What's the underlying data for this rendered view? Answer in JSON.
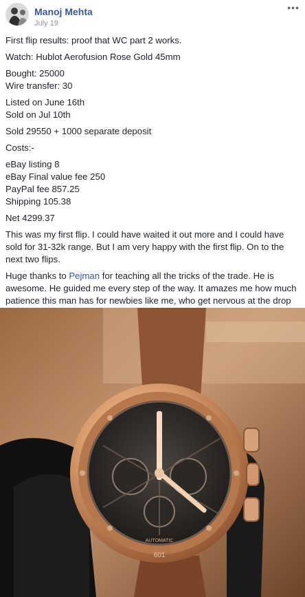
{
  "post": {
    "author": "Manoj Mehta",
    "date": "July 19",
    "more_label": "•••",
    "paragraphs": {
      "p1": "First flip results: proof that WC part 2 works.",
      "p2": "Watch: Hublot Aerofusion Rose Gold 45mm",
      "p3a": "Bought: 25000",
      "p3b": "Wire transfer: 30",
      "p4a": "Listed on June 16th",
      "p4b": "Sold on Jul 10th",
      "p5": "Sold 29550 + 1000 separate deposit",
      "p6": "Costs:-",
      "p7a": "eBay listing 8",
      "p7b": "eBay Final value fee 250",
      "p7c": "PayPal fee 857.25",
      "p7d": "Shipping 105.38",
      "p8": "Net 4299.37",
      "p9": "This was my first flip. I could have waited it out more and I could have sold for 31-32k range. But I am very happy with the first flip. On to the next two flips.",
      "p10_before": "Huge thanks to ",
      "p10_link": "Pejman",
      "p10_after": " for teaching all the tricks of the trade. He is awesome. He guided me every step of the way. It amazes me how much patience this man has for newbies like me, who get nervous at the drop of the hat. Thanks again PJ."
    },
    "photo": {
      "dial_text": "AUTOMATIC",
      "date_window": "601"
    }
  }
}
